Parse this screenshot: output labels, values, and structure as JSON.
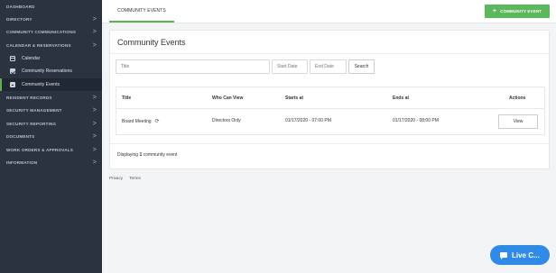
{
  "sidebar": {
    "items": [
      {
        "label": "DASHBOARD",
        "chevron": false
      },
      {
        "label": "DIRECTORY",
        "chevron": true
      },
      {
        "label": "COMMUNITY COMMUNICATIONS",
        "chevron": true
      },
      {
        "label": "CALENDAR & RESERVATIONS",
        "chevron": true
      }
    ],
    "sub_items": [
      {
        "label": "Calendar",
        "icon": "calendar-icon"
      },
      {
        "label": "Community Reservations",
        "icon": "checkbox-icon"
      },
      {
        "label": "Community Events",
        "icon": "document-icon",
        "active": true
      }
    ],
    "items_after": [
      {
        "label": "RESIDENT RECORDS",
        "chevron": true
      },
      {
        "label": "SECURITY MANAGEMENT",
        "chevron": true
      },
      {
        "label": "SECURITY REPORTING",
        "chevron": true
      },
      {
        "label": "DOCUMENTS",
        "chevron": true
      },
      {
        "label": "WORK ORDERS & APPROVALS",
        "chevron": true
      },
      {
        "label": "INFORMATION",
        "chevron": true
      }
    ],
    "chevron_glyph": ">"
  },
  "topbar": {
    "tab_label": "COMMUNITY EVENTS",
    "add_button_label": "COMMUNITY EVENT",
    "add_button_icon": "+"
  },
  "panel": {
    "title": "Community Events",
    "filters": {
      "title_placeholder": "Title",
      "start_date_placeholder": "Start Date",
      "end_date_placeholder": "End Date",
      "search_label": "Search"
    },
    "table": {
      "columns": [
        "Title",
        "Who Can View",
        "Starts at",
        "Ends at",
        "Actions"
      ],
      "rows": [
        {
          "title": "Board Meeting",
          "who_can_view": "Directors Only",
          "starts_at": "01/17/2020 - 07:00 PM",
          "ends_at": "01/17/2020 - 08:00 PM",
          "action": "View"
        }
      ]
    },
    "displaying": {
      "prefix": "Displaying",
      "count": "1",
      "suffix": "community event"
    }
  },
  "footer": {
    "privacy": "Privacy",
    "terms": "Terms"
  },
  "chat": {
    "label": "Live C..."
  },
  "colors": {
    "sidebar_bg": "#2c3340",
    "accent_green": "#5cb85c",
    "chat_blue": "#2f8be6"
  }
}
